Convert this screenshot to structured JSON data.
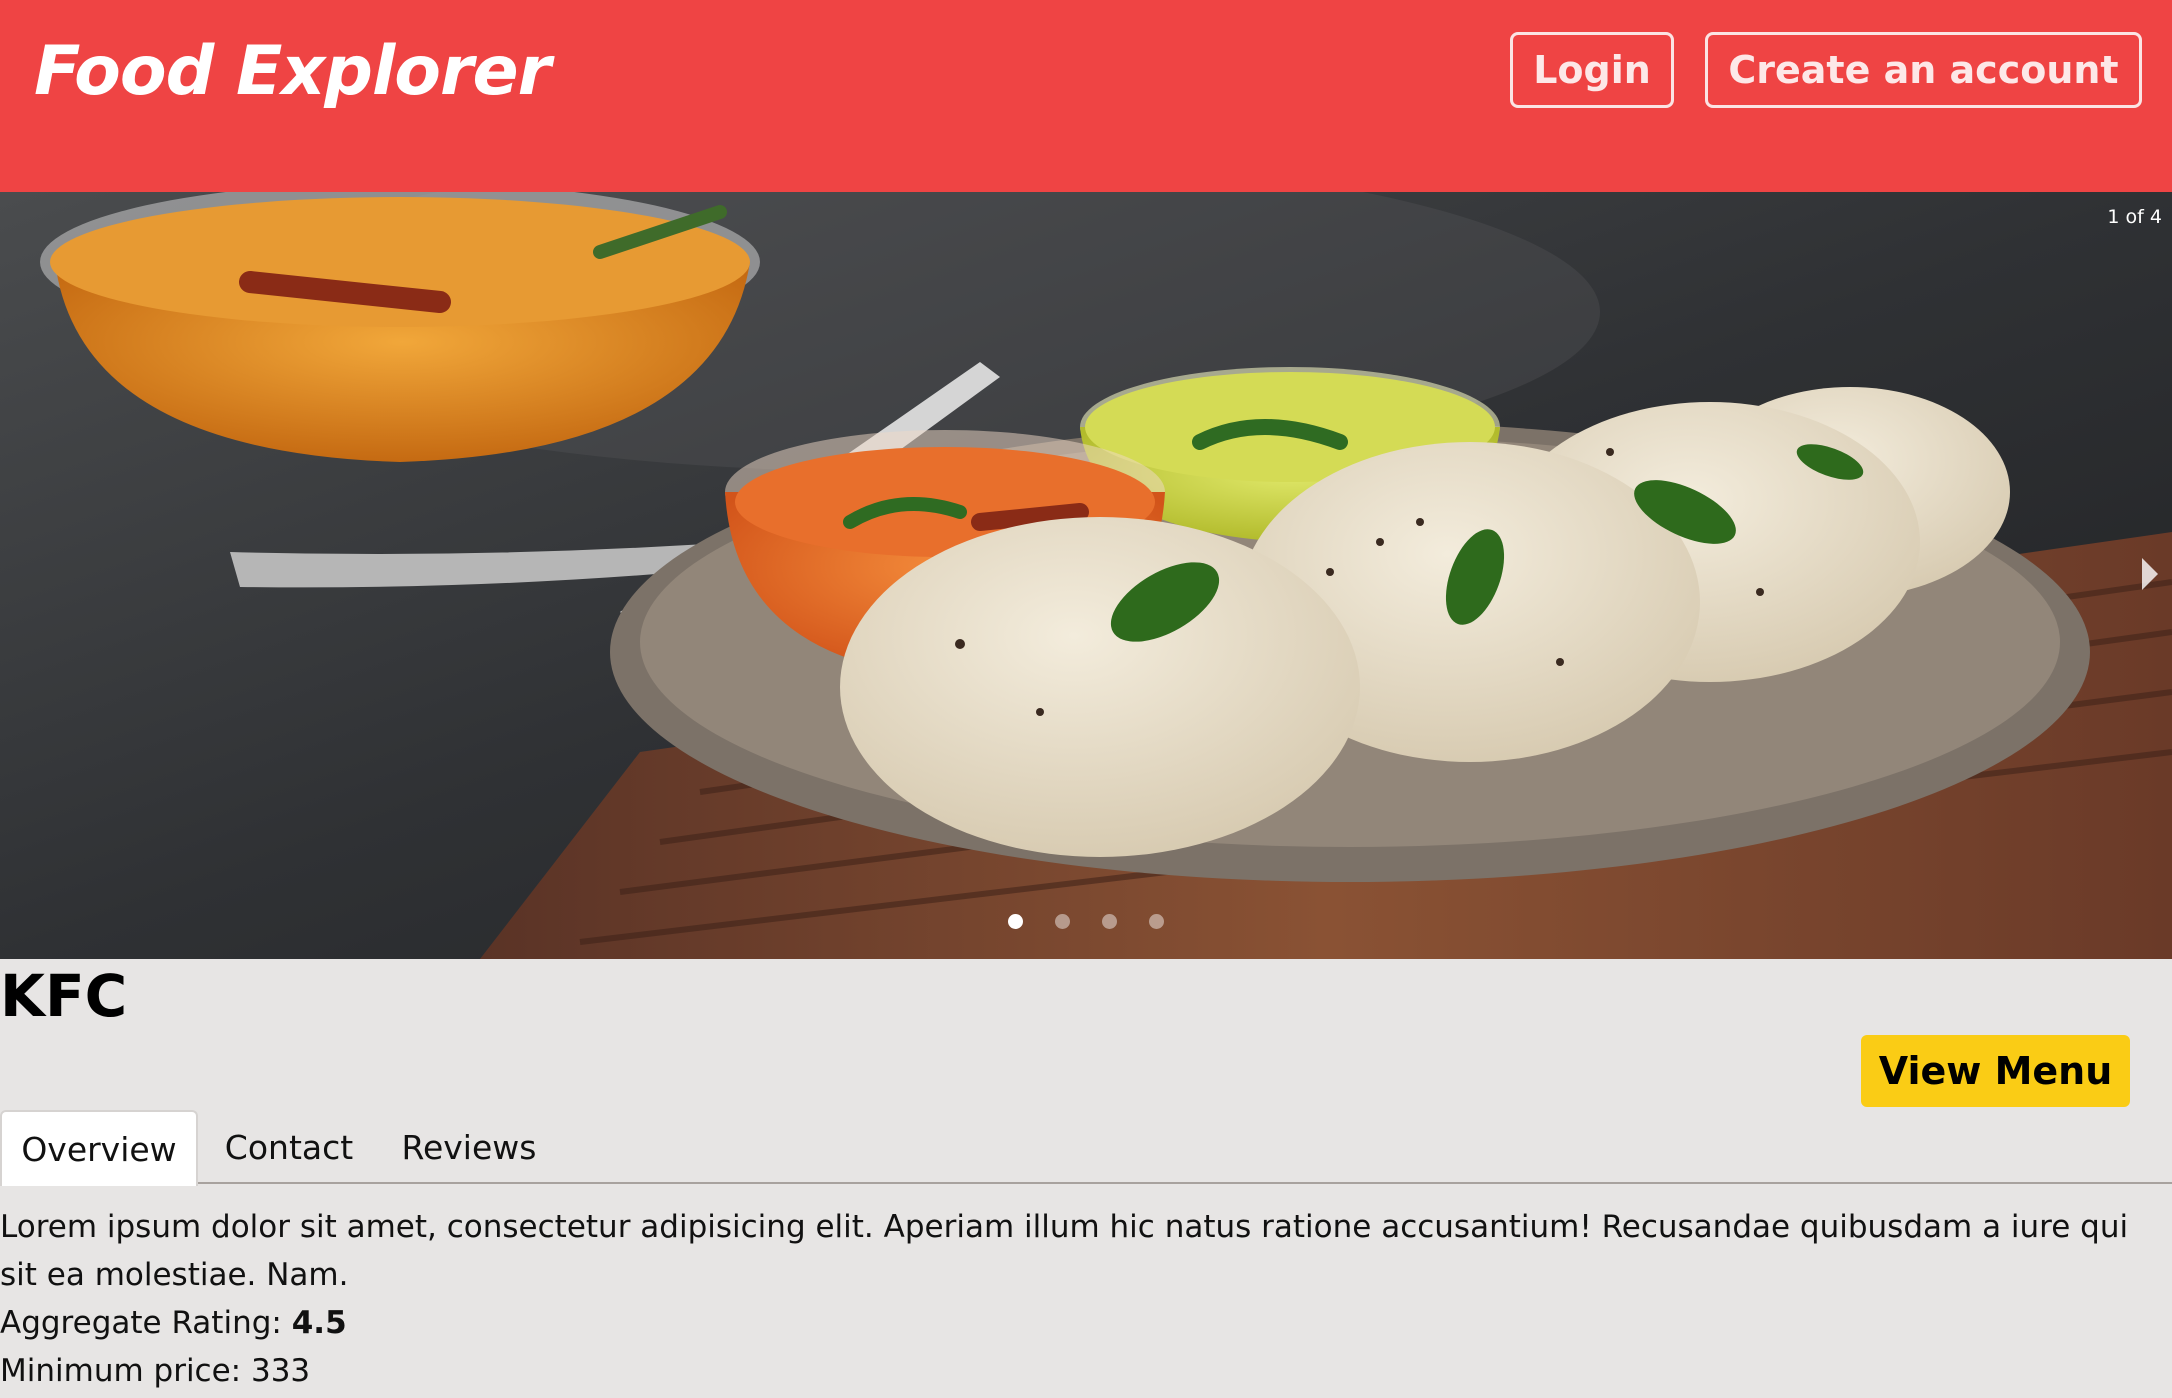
{
  "header": {
    "brand": "Food Explorer",
    "login_label": "Login",
    "create_account_label": "Create an account",
    "background_color": "#ef4444"
  },
  "carousel": {
    "counter": "1 of 4",
    "slide_count": 4,
    "active_index": 0,
    "next_icon": "chevron-right-icon"
  },
  "restaurant": {
    "name": "KFC",
    "view_menu_label": "View Menu",
    "button_color": "#facc15"
  },
  "tabs": [
    {
      "label": "Overview",
      "active": true
    },
    {
      "label": "Contact",
      "active": false
    },
    {
      "label": "Reviews",
      "active": false
    }
  ],
  "overview": {
    "description": "Lorem ipsum dolor sit amet, consectetur adipisicing elit. Aperiam illum hic natus ratione accusantium! Recusandae quibusdam a iure qui sit ea molestiae. Nam.",
    "rating_label": "Aggregate Rating:",
    "rating_value": "4.5",
    "min_price_label": "Minimum price:",
    "min_price_value": "333"
  }
}
